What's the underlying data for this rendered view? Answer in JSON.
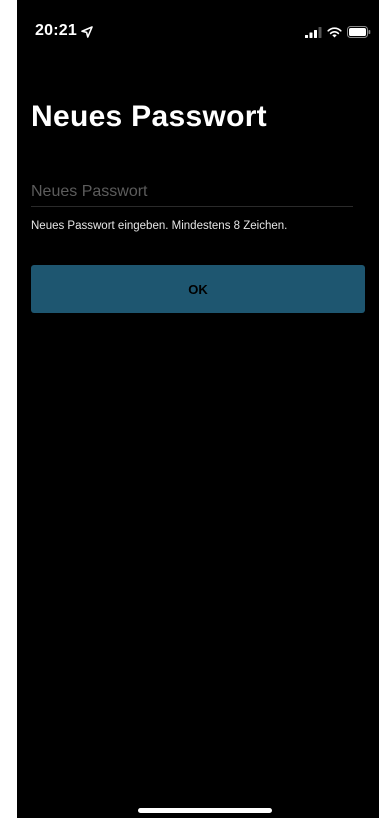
{
  "status_bar": {
    "time": "20:21",
    "icons": [
      "location-arrow-icon",
      "signal-icon",
      "wifi-icon",
      "battery-icon"
    ]
  },
  "screen": {
    "title": "Neues Passwort",
    "password_field": {
      "placeholder": "Neues Passwort",
      "value": ""
    },
    "hint": "Neues Passwort eingeben. Mindestens 8 Zeichen.",
    "ok_button_label": "OK"
  },
  "colors": {
    "background": "#000000",
    "text": "#ffffff",
    "button_background": "#1e5670",
    "button_text": "#000000",
    "placeholder": "#5c5c5c"
  }
}
